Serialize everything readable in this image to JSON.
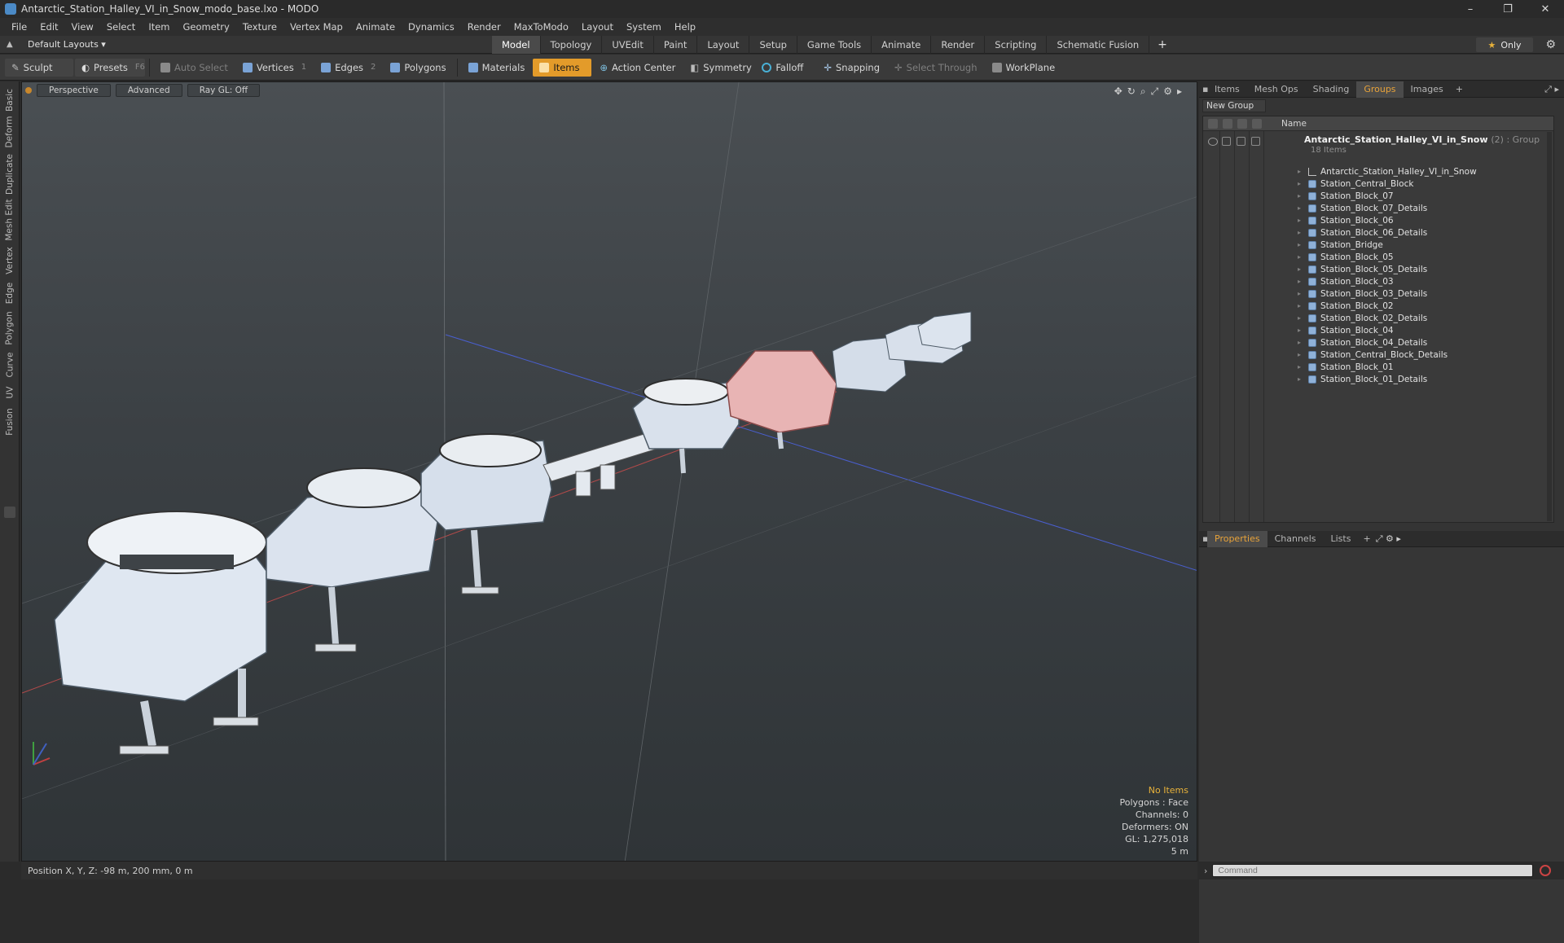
{
  "window": {
    "title": "Antarctic_Station_Halley_VI_in_Snow_modo_base.lxo - MODO",
    "controls": [
      "–",
      "❐",
      "✕"
    ]
  },
  "menu": [
    "File",
    "Edit",
    "View",
    "Select",
    "Item",
    "Geometry",
    "Texture",
    "Vertex Map",
    "Animate",
    "Dynamics",
    "Render",
    "MaxToModo",
    "Layout",
    "System",
    "Help"
  ],
  "layouts": {
    "label": "Default Layouts ▾"
  },
  "workspace_tabs": [
    "Model",
    "Topology",
    "UVEdit",
    "Paint",
    "Layout",
    "Setup",
    "Game Tools",
    "Animate",
    "Render",
    "Scripting",
    "Schematic Fusion"
  ],
  "workspace_active": "Model",
  "only_label": "Only",
  "toolbar": {
    "sculpt": "Sculpt",
    "presets": "Presets",
    "presets_key": "F6",
    "auto_select": "Auto Select",
    "vertices": "Vertices",
    "vertices_key": "1",
    "edges": "Edges",
    "edges_key": "2",
    "polygons": "Polygons",
    "materials": "Materials",
    "items": "Items",
    "action_center": "Action Center",
    "symmetry": "Symmetry",
    "falloff": "Falloff",
    "snapping": "Snapping",
    "select_through": "Select Through",
    "workplane": "WorkPlane"
  },
  "left_tabs": [
    "Basic",
    "Deform",
    "Duplicate",
    "Mesh Edit",
    "Vertex",
    "Edge",
    "Polygon",
    "Curve",
    "UV",
    "Fusion"
  ],
  "viewport": {
    "perspective": "Perspective",
    "advanced": "Advanced",
    "raygl": "Ray GL: Off",
    "stats": {
      "no_items": "No Items",
      "polygons": "Polygons : Face",
      "channels": "Channels: 0",
      "deformers": "Deformers: ON",
      "gl": "GL: 1,275,018",
      "scale": "5 m"
    }
  },
  "status": {
    "position": "Position X, Y, Z:  -98 m, 200 mm, 0 m"
  },
  "right_panel": {
    "tabs": [
      "Items",
      "Mesh Ops",
      "Shading",
      "Groups",
      "Images"
    ],
    "active_tab": "Groups",
    "new_group": "New Group",
    "column_name": "Name",
    "group": {
      "name": "Antarctic_Station_Halley_VI_in_Snow",
      "suffix": "(2) : Group",
      "count": "18 Items"
    },
    "items": [
      "Antarctic_Station_Halley_VI_in_Snow",
      "Station_Central_Block",
      "Station_Block_07",
      "Station_Block_07_Details",
      "Station_Block_06",
      "Station_Block_06_Details",
      "Station_Bridge",
      "Station_Block_05",
      "Station_Block_05_Details",
      "Station_Block_03",
      "Station_Block_03_Details",
      "Station_Block_02",
      "Station_Block_02_Details",
      "Station_Block_04",
      "Station_Block_04_Details",
      "Station_Central_Block_Details",
      "Station_Block_01",
      "Station_Block_01_Details"
    ],
    "bottom_tabs": [
      "Properties",
      "Channels",
      "Lists"
    ],
    "bottom_active": "Properties",
    "command_placeholder": "Command"
  },
  "colors": {
    "accent": "#e39b2a",
    "active_tab_text": "#e8a33a",
    "viewport_top": "#4a4f53",
    "viewport_bottom": "#2f3437",
    "module_fill": "#dfe7f1",
    "central_block": "#e8b4b4"
  }
}
